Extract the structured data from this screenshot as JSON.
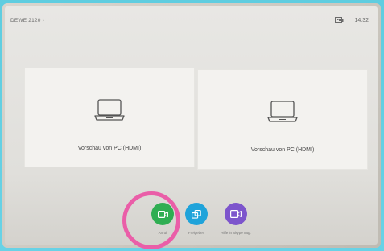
{
  "header": {
    "room_name": "DEWE 2120",
    "chevron": "›",
    "screen_icon": "screen-share-icon",
    "time": "14:32"
  },
  "previews": [
    {
      "label": "Vorschau von PC (HDMI)",
      "icon": "laptop-icon"
    },
    {
      "label": "Vorschau von PC (HDMI)",
      "icon": "laptop-icon"
    }
  ],
  "actions": [
    {
      "label": "Anruf",
      "icon": "video-camera-icon",
      "color": "#2fae52"
    },
    {
      "label": "Freigeben",
      "icon": "share-screen-icon",
      "color": "#1fa3da"
    },
    {
      "label": "Hilfe in Skype Mtg.",
      "icon": "video-meeting-icon",
      "color": "#7d55cc"
    }
  ],
  "annotation": {
    "highlight_color": "#ea5ea8"
  }
}
